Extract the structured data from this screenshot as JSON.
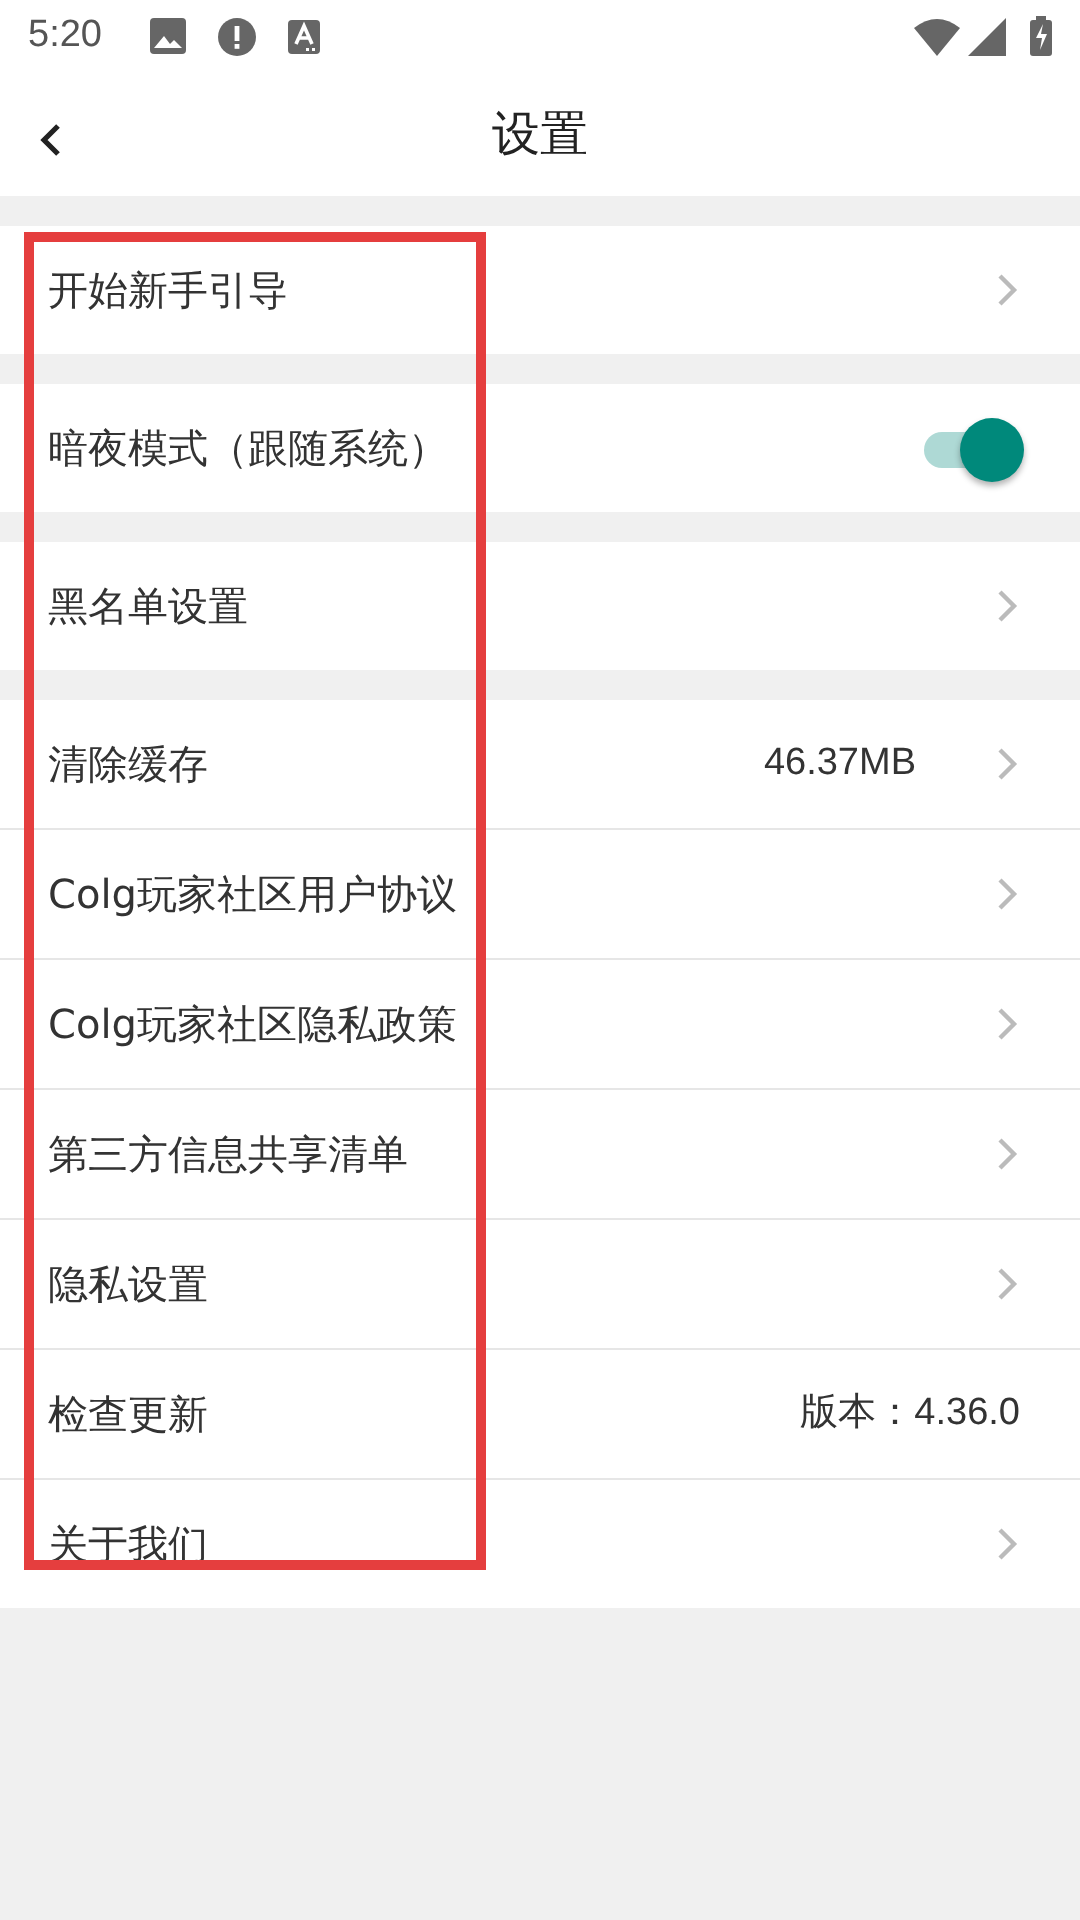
{
  "status_bar": {
    "time": "5:20"
  },
  "header": {
    "title": "设置"
  },
  "sections": [
    {
      "items": [
        {
          "kind": "link",
          "label": "开始新手引导"
        }
      ]
    },
    {
      "items": [
        {
          "kind": "toggle",
          "label": "暗夜模式（跟随系统）",
          "on": true
        }
      ]
    },
    {
      "items": [
        {
          "kind": "link",
          "label": "黑名单设置"
        }
      ]
    },
    {
      "items": [
        {
          "kind": "value",
          "label": "清除缓存",
          "value": "46.37MB"
        },
        {
          "kind": "link",
          "label": "Colg玩家社区用户协议"
        },
        {
          "kind": "link",
          "label": "Colg玩家社区隐私政策"
        },
        {
          "kind": "link",
          "label": "第三方信息共享清单"
        },
        {
          "kind": "link",
          "label": "隐私设置"
        },
        {
          "kind": "info",
          "label": "检查更新",
          "value": "版本：4.36.0"
        },
        {
          "kind": "link",
          "label": "关于我们"
        }
      ]
    }
  ]
}
